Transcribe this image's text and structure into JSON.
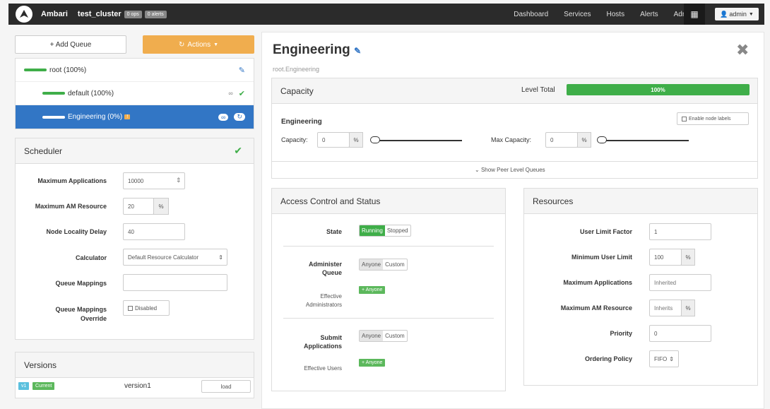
{
  "navbar": {
    "brand": "Ambari",
    "cluster": "test_cluster",
    "ops_badge": "0 ops",
    "alerts_badge": "0 alerts",
    "links": [
      "Dashboard",
      "Services",
      "Hosts",
      "Alerts",
      "Admin"
    ],
    "user": "admin"
  },
  "left": {
    "add_queue": "+ Add Queue",
    "actions": "Actions",
    "queues": [
      {
        "label": "root (100%)"
      },
      {
        "label": "default (100%)"
      },
      {
        "label": "Engineering (0%)",
        "warn": "!"
      }
    ],
    "scheduler": {
      "title": "Scheduler",
      "max_apps_label": "Maximum Applications",
      "max_apps_value": "10000",
      "max_am_label": "Maximum AM Resource",
      "max_am_value": "20",
      "percent": "%",
      "locality_label": "Node Locality Delay",
      "locality_value": "40",
      "calculator_label": "Calculator",
      "calculator_value": "Default Resource Calculator",
      "mappings_label": "Queue Mappings",
      "mappings_value": "",
      "override_label_1": "Queue Mappings",
      "override_label_2": "Override",
      "override_value": "Disabled"
    },
    "versions": {
      "title": "Versions",
      "badge_v": "v1",
      "badge_current": "Current",
      "version": "version1",
      "load": "load"
    }
  },
  "main": {
    "title": "Engineering",
    "path": "root.Engineering",
    "capacity": {
      "title": "Capacity",
      "level_total_label": "Level Total",
      "level_total_value": "100%",
      "level_total_fraction": 1.0,
      "queue_name": "Engineering",
      "enable_node_labels": "Enable node labels",
      "capacity_label": "Capacity:",
      "capacity_value": "0",
      "max_capacity_label": "Max Capacity:",
      "max_capacity_value": "0",
      "percent": "%",
      "peer_link": "Show Peer Level Queues"
    },
    "access": {
      "title": "Access Control and Status",
      "state_label": "State",
      "state_running": "Running",
      "state_stopped": "Stopped",
      "admin_queue_label_1": "Administer",
      "admin_queue_label_2": "Queue",
      "anyone": "Anyone",
      "custom": "Custom",
      "effective_admins_1": "Effective",
      "effective_admins_2": "Administrators",
      "anyone_badge": "Anyone",
      "submit_label_1": "Submit",
      "submit_label_2": "Applications",
      "effective_users": "Effective Users"
    },
    "resources": {
      "title": "Resources",
      "user_limit_factor_label": "User Limit Factor",
      "user_limit_factor_value": "1",
      "min_user_limit_label": "Minimum User Limit",
      "min_user_limit_value": "100",
      "max_apps_label": "Maximum Applications",
      "max_apps_placeholder": "Inherited",
      "max_am_label": "Maximum AM Resource",
      "max_am_placeholder": "Inherits",
      "priority_label": "Priority",
      "priority_value": "0",
      "ordering_label": "Ordering Policy",
      "ordering_value": "FIFO",
      "percent": "%"
    }
  },
  "colors": {
    "accent_green": "#3fae49",
    "selected_blue": "#3276c5",
    "actions_orange": "#f0ad4e",
    "navbar": "#2b2b2b"
  }
}
